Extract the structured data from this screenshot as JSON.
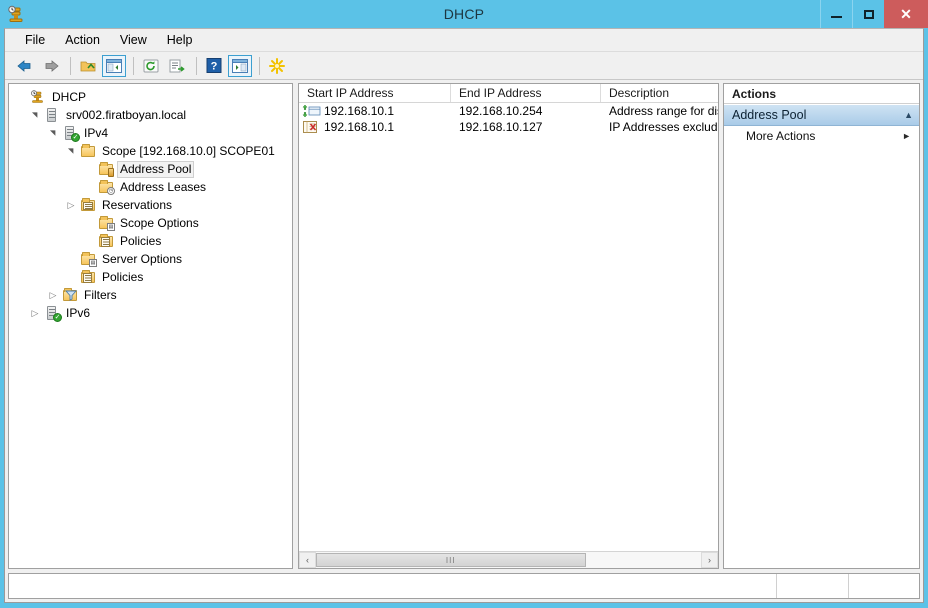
{
  "window": {
    "title": "DHCP",
    "app_icon": "dhcp-server-icon",
    "minimize_label": "",
    "maximize_label": "",
    "close_label": "✕"
  },
  "menubar": {
    "items": [
      {
        "label": "File"
      },
      {
        "label": "Action"
      },
      {
        "label": "View"
      },
      {
        "label": "Help"
      }
    ]
  },
  "toolbar": {
    "buttons": [
      {
        "name": "back-icon",
        "glyph": "back"
      },
      {
        "name": "forward-icon",
        "glyph": "forward"
      },
      {
        "name": "up-one-level-icon",
        "glyph": "up-folder"
      },
      {
        "name": "show-hide-console-tree-icon",
        "glyph": "tree-pane"
      },
      {
        "name": "refresh-icon",
        "glyph": "refresh"
      },
      {
        "name": "export-list-icon",
        "glyph": "export"
      },
      {
        "name": "help-icon",
        "glyph": "help"
      },
      {
        "name": "show-hide-action-pane-icon",
        "glyph": "action-pane"
      },
      {
        "name": "new-scope-icon",
        "glyph": "sparkle"
      }
    ]
  },
  "tree": {
    "nodes": [
      {
        "label": "DHCP",
        "depth": 0,
        "twisty": "none",
        "icon": "dhcp-root-icon",
        "selected": false
      },
      {
        "label": "srv002.firatboyan.local",
        "depth": 1,
        "twisty": "open",
        "icon": "server-icon",
        "selected": false
      },
      {
        "label": "IPv4",
        "depth": 2,
        "twisty": "open",
        "icon": "server-check-icon",
        "selected": false
      },
      {
        "label": "Scope [192.168.10.0] SCOPE01",
        "depth": 3,
        "twisty": "open",
        "icon": "folder-icon",
        "selected": false
      },
      {
        "label": "Address Pool",
        "depth": 4,
        "twisty": "none",
        "icon": "address-pool-icon",
        "selected": true
      },
      {
        "label": "Address Leases",
        "depth": 4,
        "twisty": "none",
        "icon": "address-leases-icon",
        "selected": false
      },
      {
        "label": "Reservations",
        "depth": 4,
        "twisty": "closed",
        "icon": "reservations-icon",
        "selected": false
      },
      {
        "label": "Scope Options",
        "depth": 4,
        "twisty": "none",
        "icon": "scope-options-icon",
        "selected": false
      },
      {
        "label": "Policies",
        "depth": 4,
        "twisty": "none",
        "icon": "policies-icon",
        "selected": false
      },
      {
        "label": "Server Options",
        "depth": 3,
        "twisty": "none",
        "icon": "server-options-icon",
        "selected": false
      },
      {
        "label": "Policies",
        "depth": 3,
        "twisty": "none",
        "icon": "policies-icon",
        "selected": false
      },
      {
        "label": "Filters",
        "depth": 3,
        "twisty": "closed",
        "icon": "filters-icon",
        "selected": false
      },
      {
        "label": "IPv6",
        "depth": 2,
        "twisty": "closed",
        "icon": "server-check-icon",
        "selected": false
      }
    ]
  },
  "list": {
    "columns": [
      {
        "label": "Start IP Address"
      },
      {
        "label": "End IP Address"
      },
      {
        "label": "Description"
      }
    ],
    "rows": [
      {
        "icon": "address-range-icon",
        "start_ip": "192.168.10.1",
        "end_ip": "192.168.10.254",
        "description": "Address range for distr"
      },
      {
        "icon": "exclusion-range-icon",
        "start_ip": "192.168.10.1",
        "end_ip": "192.168.10.127",
        "description": "IP Addresses excluded"
      }
    ],
    "scroll": {
      "left_arrow": "‹",
      "right_arrow": "›",
      "thumb_grip": "III"
    }
  },
  "actions": {
    "header": "Actions",
    "section": {
      "label": "Address Pool",
      "chevron": "▲"
    },
    "items": [
      {
        "label": "More Actions",
        "arrow": "►"
      }
    ]
  },
  "statusbar": {
    "text": ""
  },
  "colors": {
    "window_frame": "#5bc2e7",
    "close_button": "#cd5c5c",
    "action_section": "#a9cbe8",
    "toolbar_frame": "#3c9fd0"
  }
}
